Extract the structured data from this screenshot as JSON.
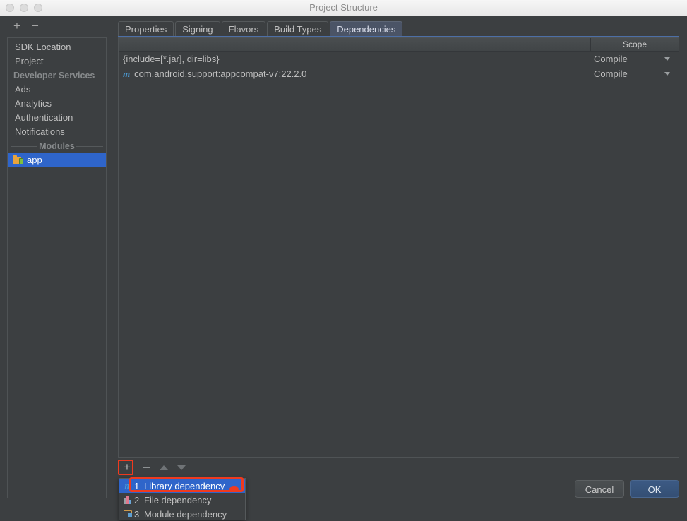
{
  "window": {
    "title": "Project Structure",
    "traffic_lights": [
      "close-button",
      "minimize-button",
      "maximize-button"
    ]
  },
  "left_toolbar": {
    "add_label": "+",
    "remove_label": "−"
  },
  "sidebar": {
    "items": [
      {
        "label": "SDK Location",
        "type": "item",
        "selected": false
      },
      {
        "label": "Project",
        "type": "item",
        "selected": false
      },
      {
        "label": "Developer Services",
        "type": "group"
      },
      {
        "label": "Ads",
        "type": "item",
        "selected": false
      },
      {
        "label": "Analytics",
        "type": "item",
        "selected": false
      },
      {
        "label": "Authentication",
        "type": "item",
        "selected": false
      },
      {
        "label": "Notifications",
        "type": "item",
        "selected": false
      },
      {
        "label": "Modules",
        "type": "group"
      },
      {
        "label": "app",
        "type": "module",
        "selected": true,
        "icon": "module-folder-icon"
      }
    ]
  },
  "tabs": [
    {
      "label": "Properties",
      "active": false
    },
    {
      "label": "Signing",
      "active": false
    },
    {
      "label": "Flavors",
      "active": false
    },
    {
      "label": "Build Types",
      "active": false
    },
    {
      "label": "Dependencies",
      "active": true
    }
  ],
  "table": {
    "columns": [
      "",
      "Scope"
    ],
    "rows": [
      {
        "icon": "",
        "name": "{include=[*.jar], dir=libs}",
        "scope": "Compile"
      },
      {
        "icon": "maven-icon",
        "name": "com.android.support:appcompat-v7:22.2.0",
        "scope": "Compile"
      }
    ]
  },
  "table_toolbar": {
    "add": "+",
    "remove": "−",
    "move_up": "move-up",
    "move_down": "move-down"
  },
  "popup_menu": {
    "items": [
      {
        "num": "1",
        "label": "Library dependency",
        "icon": "maven-icon",
        "highlighted": true
      },
      {
        "num": "2",
        "label": "File dependency",
        "icon": "file-bars-icon",
        "highlighted": false
      },
      {
        "num": "3",
        "label": "Module dependency",
        "icon": "module-folder-icon",
        "highlighted": false
      }
    ]
  },
  "dialog_buttons": {
    "cancel": "Cancel",
    "ok": "OK"
  },
  "colors": {
    "background": "#3c3f41",
    "selection_blue": "#2f65ca",
    "accent_tab": "#4d6fa6",
    "annotation_red": "#ef3a1f",
    "maven_blue": "#4c9bd4"
  }
}
